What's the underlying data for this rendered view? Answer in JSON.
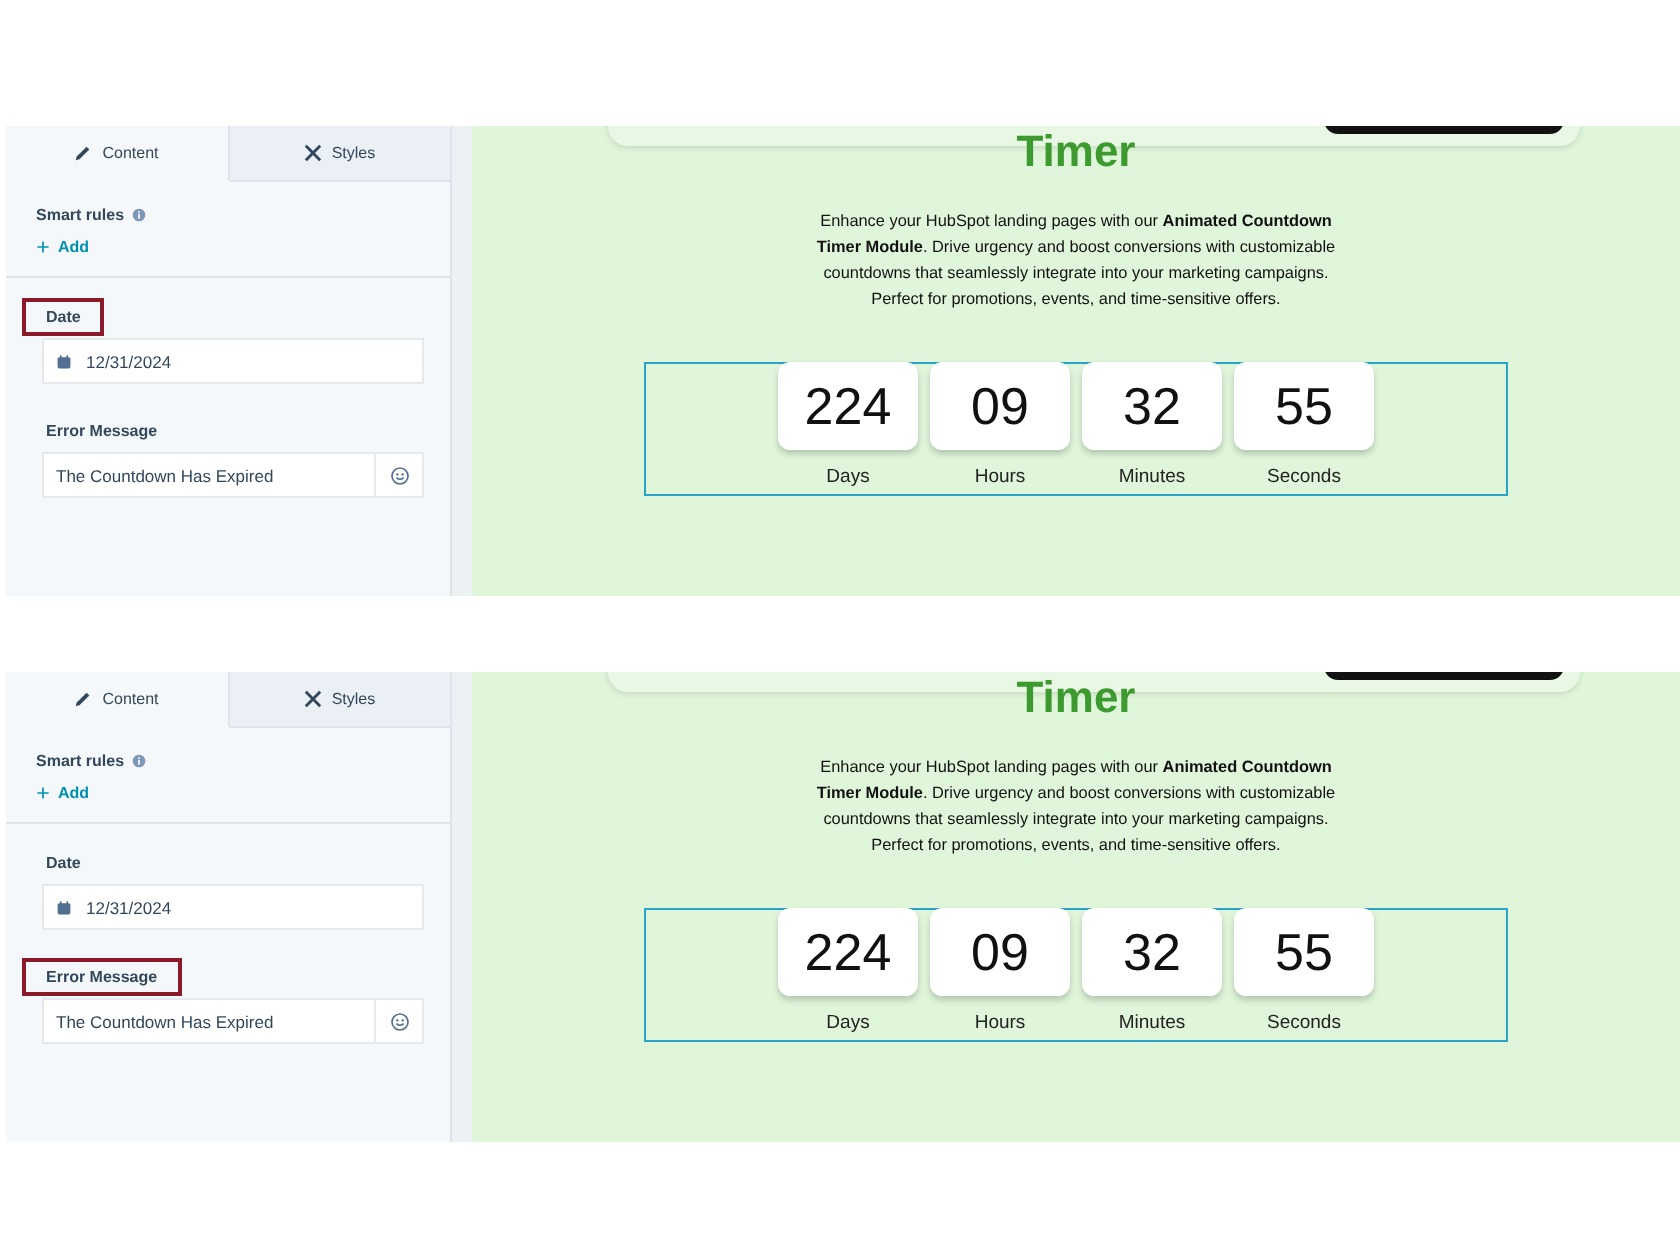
{
  "panels": [
    {
      "tabs": [
        {
          "label": "Content",
          "selected": true
        },
        {
          "label": "Styles",
          "selected": false
        }
      ],
      "smart_rules": {
        "label": "Smart rules",
        "add": "Add"
      },
      "fields": [
        {
          "label": "Date",
          "kind": "date",
          "value": "12/31/2024",
          "highlighted": true
        },
        {
          "label": "Error Message",
          "kind": "text",
          "value": "The Countdown Has Expired",
          "highlighted": false
        }
      ],
      "preview": {
        "title": "Timer",
        "description": "Enhance your HubSpot landing pages with our **Animated Countdown Timer Module**. Drive urgency and boost conversions with customizable countdowns that seamlessly integrate into your marketing campaigns. Perfect for promotions, events, and time-sensitive offers.",
        "timer": [
          {
            "value": "224",
            "unit": "Days"
          },
          {
            "value": "09",
            "unit": "Hours"
          },
          {
            "value": "32",
            "unit": "Minutes"
          },
          {
            "value": "55",
            "unit": "Seconds"
          }
        ]
      }
    },
    {
      "tabs": [
        {
          "label": "Content",
          "selected": true
        },
        {
          "label": "Styles",
          "selected": false
        }
      ],
      "smart_rules": {
        "label": "Smart rules",
        "add": "Add"
      },
      "fields": [
        {
          "label": "Date",
          "kind": "date",
          "value": "12/31/2024",
          "highlighted": false
        },
        {
          "label": "Error Message",
          "kind": "text",
          "value": "The Countdown Has Expired",
          "highlighted": true
        }
      ],
      "preview": {
        "title": "Timer",
        "description": "Enhance your HubSpot landing pages with our **Animated Countdown Timer Module**. Drive urgency and boost conversions with customizable countdowns that seamlessly integrate into your marketing campaigns. Perfect for promotions, events, and time-sensitive offers.",
        "timer": [
          {
            "value": "224",
            "unit": "Days"
          },
          {
            "value": "09",
            "unit": "Hours"
          },
          {
            "value": "32",
            "unit": "Minutes"
          },
          {
            "value": "55",
            "unit": "Seconds"
          }
        ]
      }
    }
  ]
}
